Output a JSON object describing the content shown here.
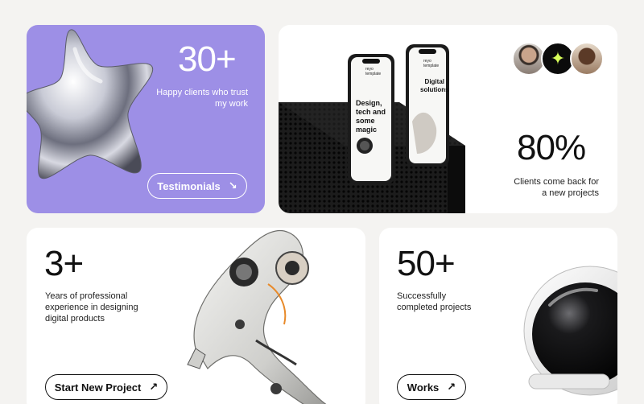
{
  "stats": {
    "clients": {
      "value": "30+",
      "caption": "Happy clients who trust my work",
      "button": "Testimonials",
      "button_icon": "arrow-down-right-icon"
    },
    "return": {
      "value": "80%",
      "caption": "Clients come back for a new projects"
    },
    "experience": {
      "value": "3+",
      "caption": "Years of professional experience in designing digital products",
      "button": "Start New Project",
      "button_icon": "arrow-up-right-icon"
    },
    "projects": {
      "value": "50+",
      "caption": "Successfully completed projects",
      "button": "Works",
      "button_icon": "arrow-up-right-icon"
    }
  },
  "phones": {
    "left": {
      "brand": "reyo template",
      "headline": "Design, tech and some magic"
    },
    "right": {
      "brand": "reyo template",
      "headline": "Digital solutions"
    }
  },
  "colors": {
    "accent_purple": "#9d8fe6",
    "background": "#f4f3f1",
    "card": "#ffffff",
    "spark": "#d9ff5a"
  }
}
